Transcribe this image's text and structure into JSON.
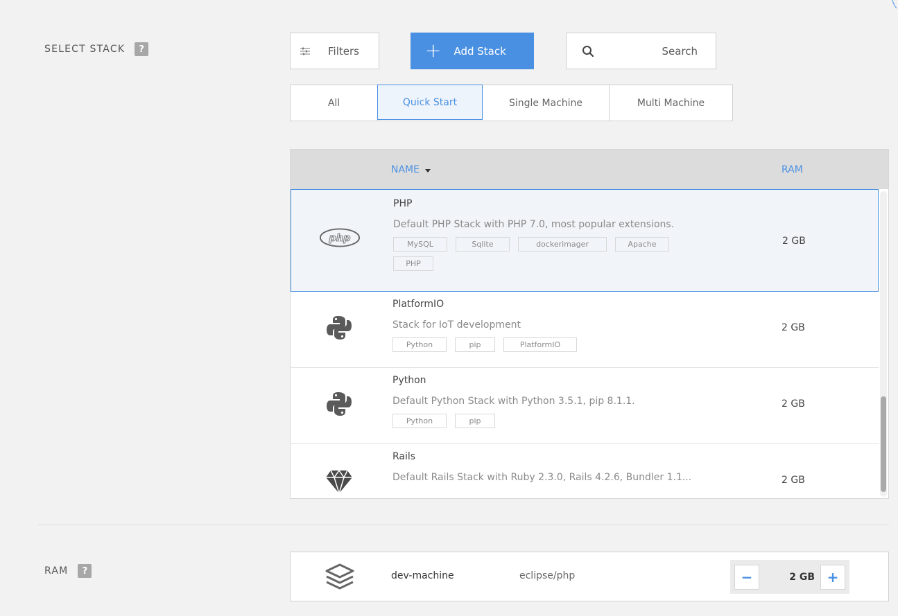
{
  "sections": {
    "select_stack_label": "SELECT STACK",
    "ram_label": "RAM",
    "help_glyph": "?"
  },
  "toolbar": {
    "filters_label": "Filters",
    "add_stack_label": "Add Stack",
    "add_glyph": "+",
    "search_label": "Search"
  },
  "tabs": [
    {
      "label": "All",
      "active": false
    },
    {
      "label": "Quick Start",
      "active": true
    },
    {
      "label": "Single Machine",
      "active": false
    },
    {
      "label": "Multi Machine",
      "active": false
    }
  ],
  "table": {
    "col_name": "NAME",
    "col_ram": "RAM",
    "rows": [
      {
        "name": "PHP",
        "description": "Default PHP Stack with PHP 7.0, most popular extensions.",
        "tags": [
          "MySQL",
          "Sqlite",
          "dockerimager",
          "Apache",
          "PHP"
        ],
        "ram": "2 GB",
        "icon": "php-icon",
        "selected": true
      },
      {
        "name": "PlatformIO",
        "description": "Stack for IoT development",
        "tags": [
          "Python",
          "pip",
          "PlatformIO"
        ],
        "ram": "2 GB",
        "icon": "python-icon",
        "selected": false
      },
      {
        "name": "Python",
        "description": "Default Python Stack with Python 3.5.1, pip 8.1.1.",
        "tags": [
          "Python",
          "pip"
        ],
        "ram": "2 GB",
        "icon": "python-icon",
        "selected": false
      },
      {
        "name": "Rails",
        "description": "Default Rails Stack with Ruby 2.3.0, Rails 4.2.6, Bundler 1.1...",
        "tags": [],
        "ram": "2 GB",
        "icon": "ruby-gem-icon",
        "selected": false
      }
    ]
  },
  "machine": {
    "name": "dev-machine",
    "image": "eclipse/php",
    "ram_value": "2 GB",
    "minus_glyph": "−",
    "plus_glyph": "+"
  },
  "colors": {
    "accent": "#4a90e2",
    "background": "#f2f2f2",
    "header_bg": "#dcdcdc"
  }
}
